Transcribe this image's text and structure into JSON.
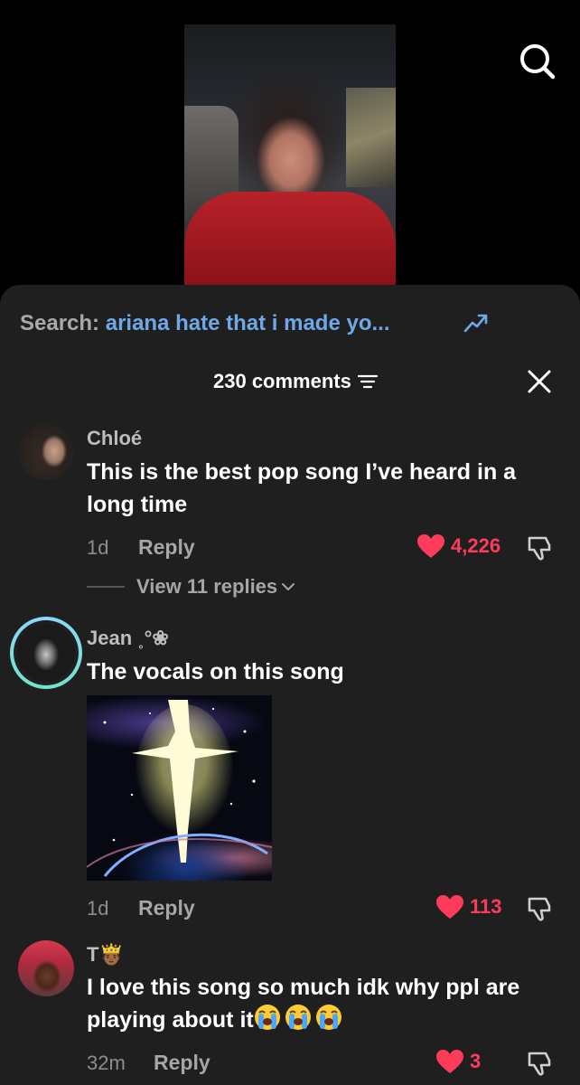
{
  "header": {
    "search_icon": "search-icon"
  },
  "search_bar": {
    "label": "Search:",
    "query": "ariana hate that i made yo...",
    "trend_icon": "trending-up-icon"
  },
  "comments_header": {
    "count_label": "230 comments",
    "filter_icon": "filter-icon",
    "close_icon": "close-icon"
  },
  "comments": [
    {
      "username": "Chloé",
      "text": "This is the best pop song I’ve heard in a long time",
      "time": "1d",
      "reply_label": "Reply",
      "likes": "4,226",
      "view_replies": "View 11 replies"
    },
    {
      "username": "Jean ˳°❀",
      "text": "The vocals on this song",
      "time": "1d",
      "reply_label": "Reply",
      "likes": "113"
    },
    {
      "username": "T🤴🏾",
      "text": "I love this song so much idk why ppl are playing about it",
      "emoji_label": "loudly-crying-face-emoji",
      "time": "32m",
      "reply_label": "Reply",
      "likes": "3"
    }
  ],
  "colors": {
    "accent_link": "#6fa8e8",
    "like_red": "#ff3b5c",
    "sheet_bg": "#1f1f1f"
  }
}
